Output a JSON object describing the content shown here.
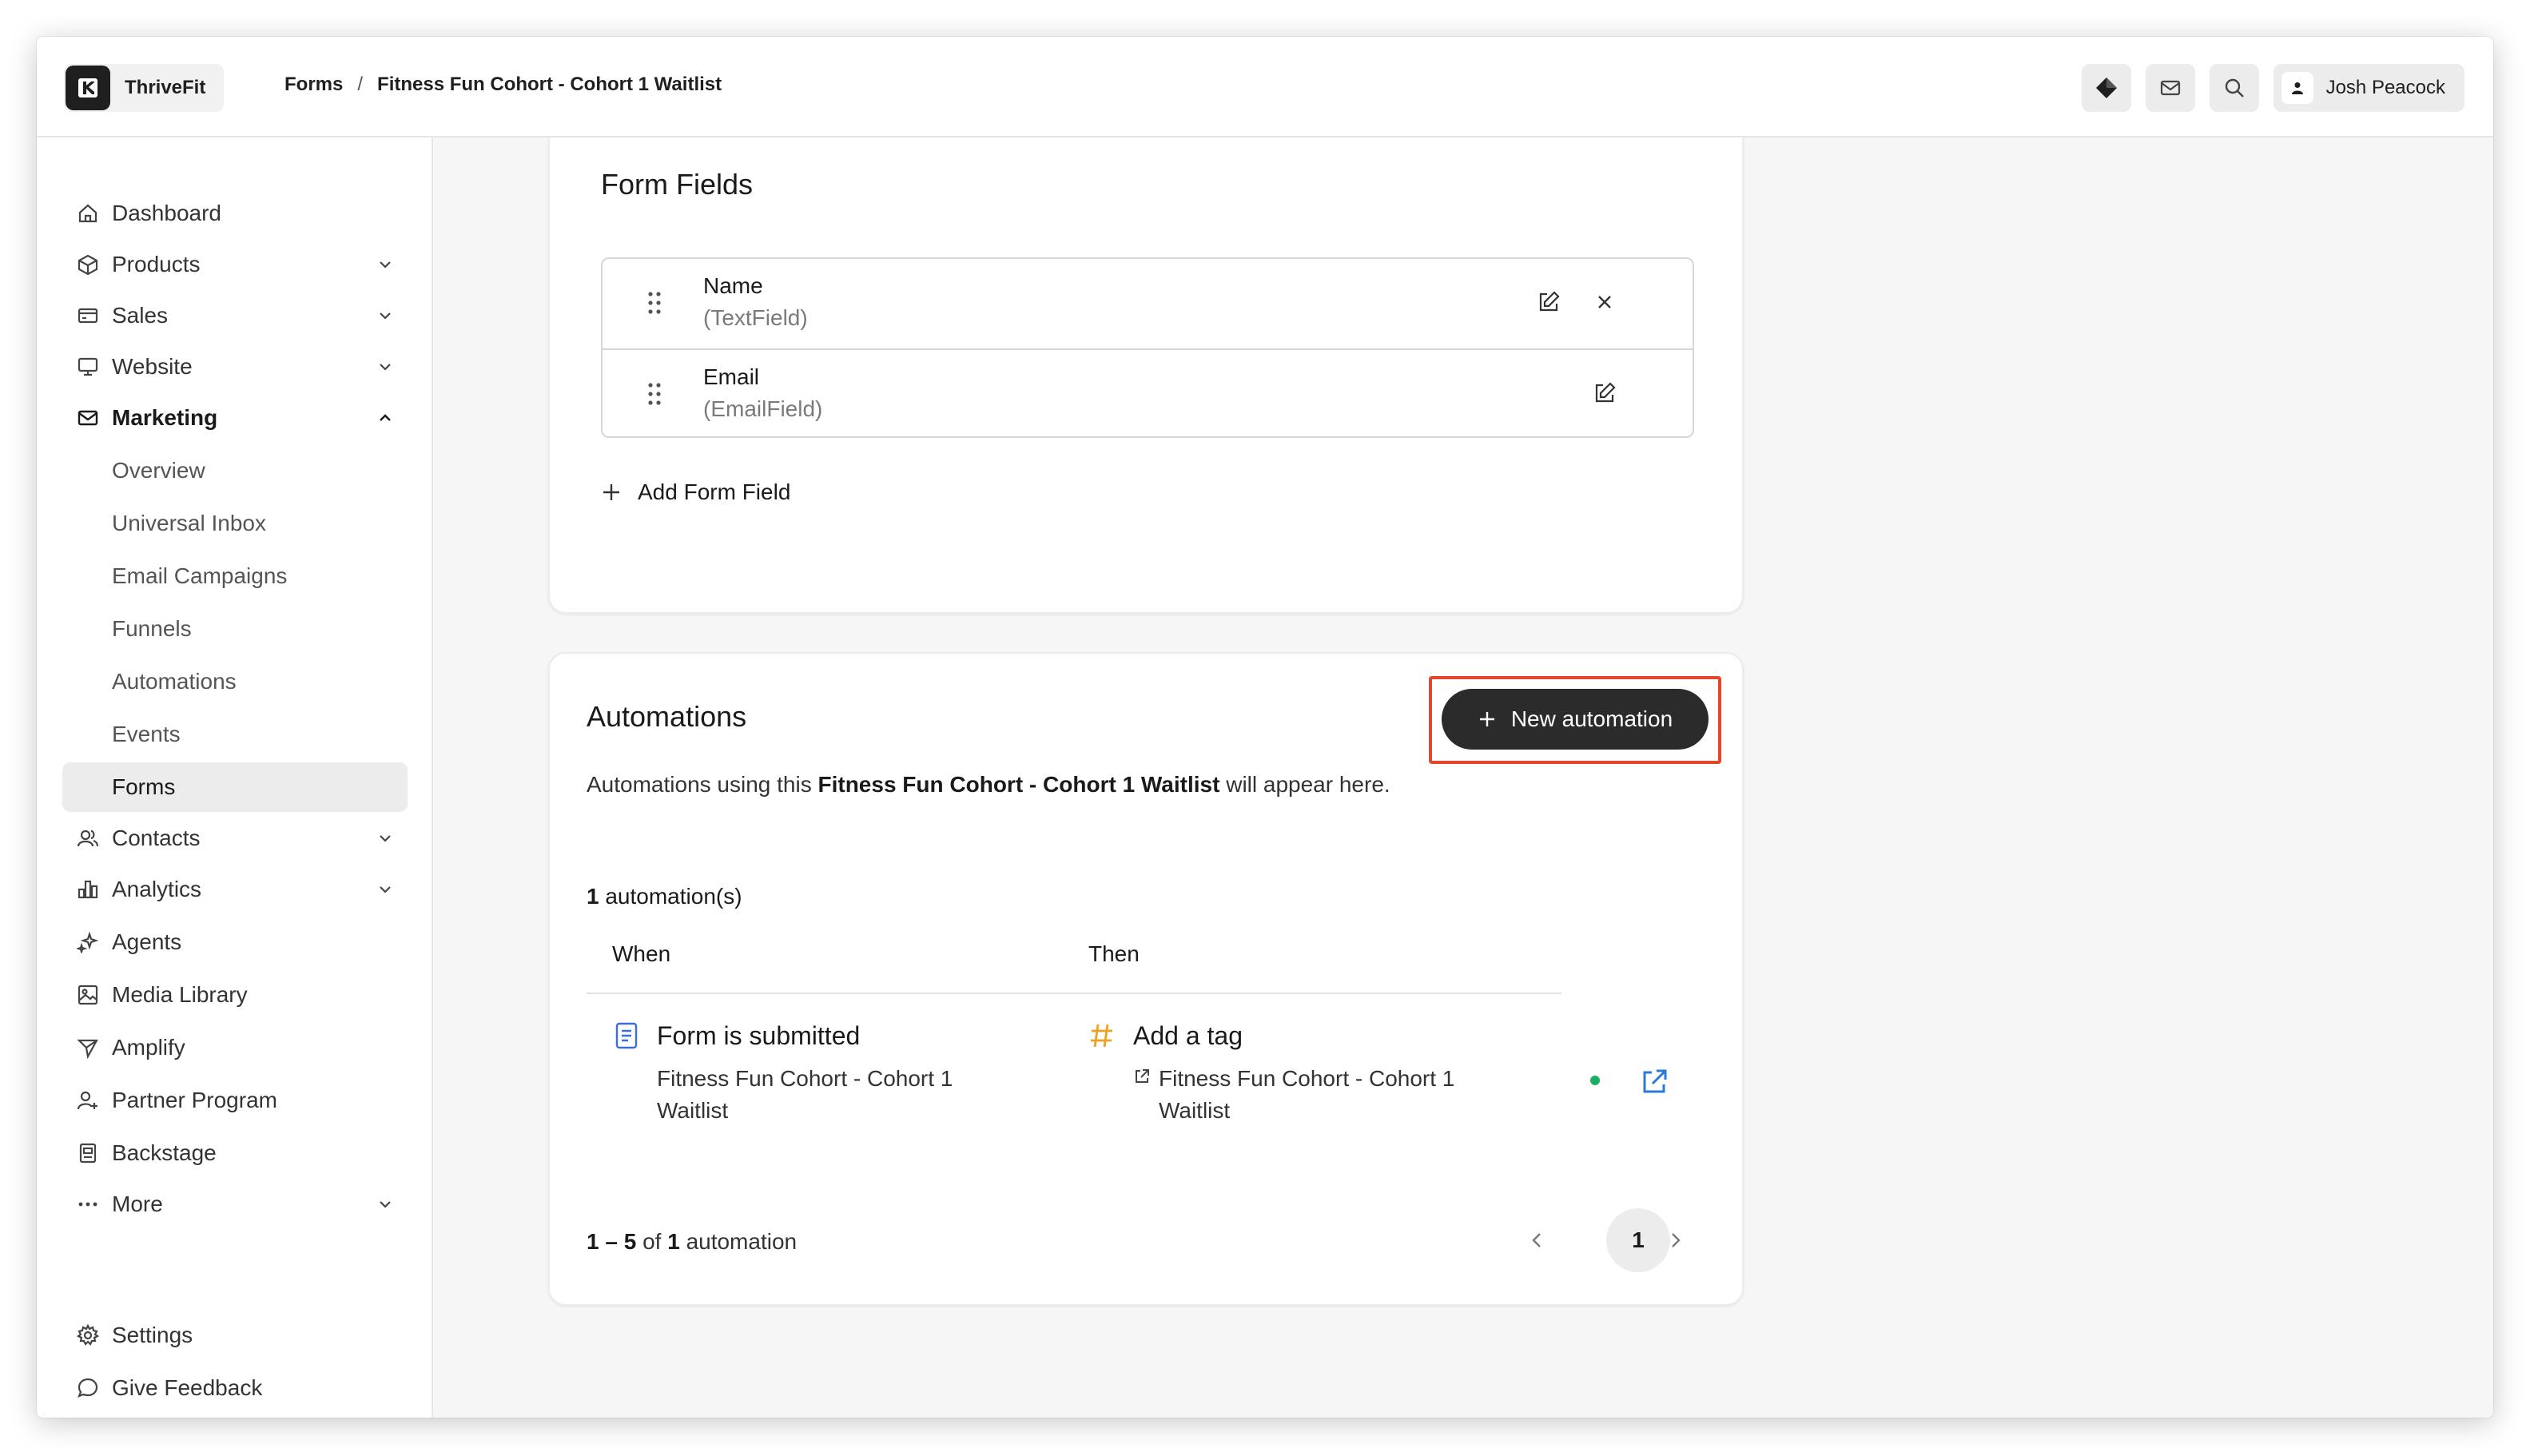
{
  "app": {
    "name": "ThriveFit"
  },
  "breadcrumb": {
    "root": "Forms",
    "separator": "/",
    "current": "Fitness Fun Cohort - Cohort 1 Waitlist"
  },
  "user": {
    "name": "Josh Peacock"
  },
  "sidebar": {
    "items": [
      {
        "label": "Dashboard",
        "icon": "home-icon"
      },
      {
        "label": "Products",
        "icon": "box-icon"
      },
      {
        "label": "Sales",
        "icon": "card-icon"
      },
      {
        "label": "Website",
        "icon": "monitor-icon"
      },
      {
        "label": "Marketing",
        "icon": "mail-icon"
      },
      {
        "label": "Contacts",
        "icon": "users-icon"
      },
      {
        "label": "Analytics",
        "icon": "chart-icon"
      },
      {
        "label": "Agents",
        "icon": "sparkle-icon"
      },
      {
        "label": "Media Library",
        "icon": "image-icon"
      },
      {
        "label": "Amplify",
        "icon": "send-icon"
      },
      {
        "label": "Partner Program",
        "icon": "partner-icon"
      },
      {
        "label": "Backstage",
        "icon": "backstage-icon"
      },
      {
        "label": "More",
        "icon": "dots-icon"
      }
    ],
    "marketing_sub": [
      "Overview",
      "Universal Inbox",
      "Email Campaigns",
      "Funnels",
      "Automations",
      "Events",
      "Forms"
    ],
    "footer": {
      "settings": "Settings",
      "feedback": "Give Feedback"
    }
  },
  "form_fields": {
    "title": "Form Fields",
    "fields": [
      {
        "name": "Name",
        "type": "(TextField)"
      },
      {
        "name": "Email",
        "type": "(EmailField)"
      }
    ],
    "add_label": "Add Form Field"
  },
  "automations": {
    "title": "Automations",
    "new_button": "New automation",
    "desc_prefix": "Automations using this",
    "desc_form": "Fitness Fun Cohort - Cohort 1 Waitlist",
    "desc_suffix": "will appear here.",
    "count_number": "1",
    "count_label": "automation(s)",
    "columns": {
      "when": "When",
      "then": "Then"
    },
    "row": {
      "when_title": "Form is submitted",
      "when_sub": "Fitness Fun Cohort - Cohort 1 Waitlist",
      "then_title": "Add a tag",
      "then_sub": "Fitness Fun Cohort - Cohort 1 Waitlist",
      "status": "active"
    },
    "pager": {
      "range": "1 – 5",
      "of": "of",
      "total": "1",
      "unit": "automation",
      "page": "1"
    }
  },
  "colors": {
    "accent": "#2b2b2b",
    "highlight": "#e5452a",
    "tag": "#f0a020",
    "form_icon": "#3b6fd8",
    "status": "#1eae63",
    "link": "#2a7ad8"
  }
}
